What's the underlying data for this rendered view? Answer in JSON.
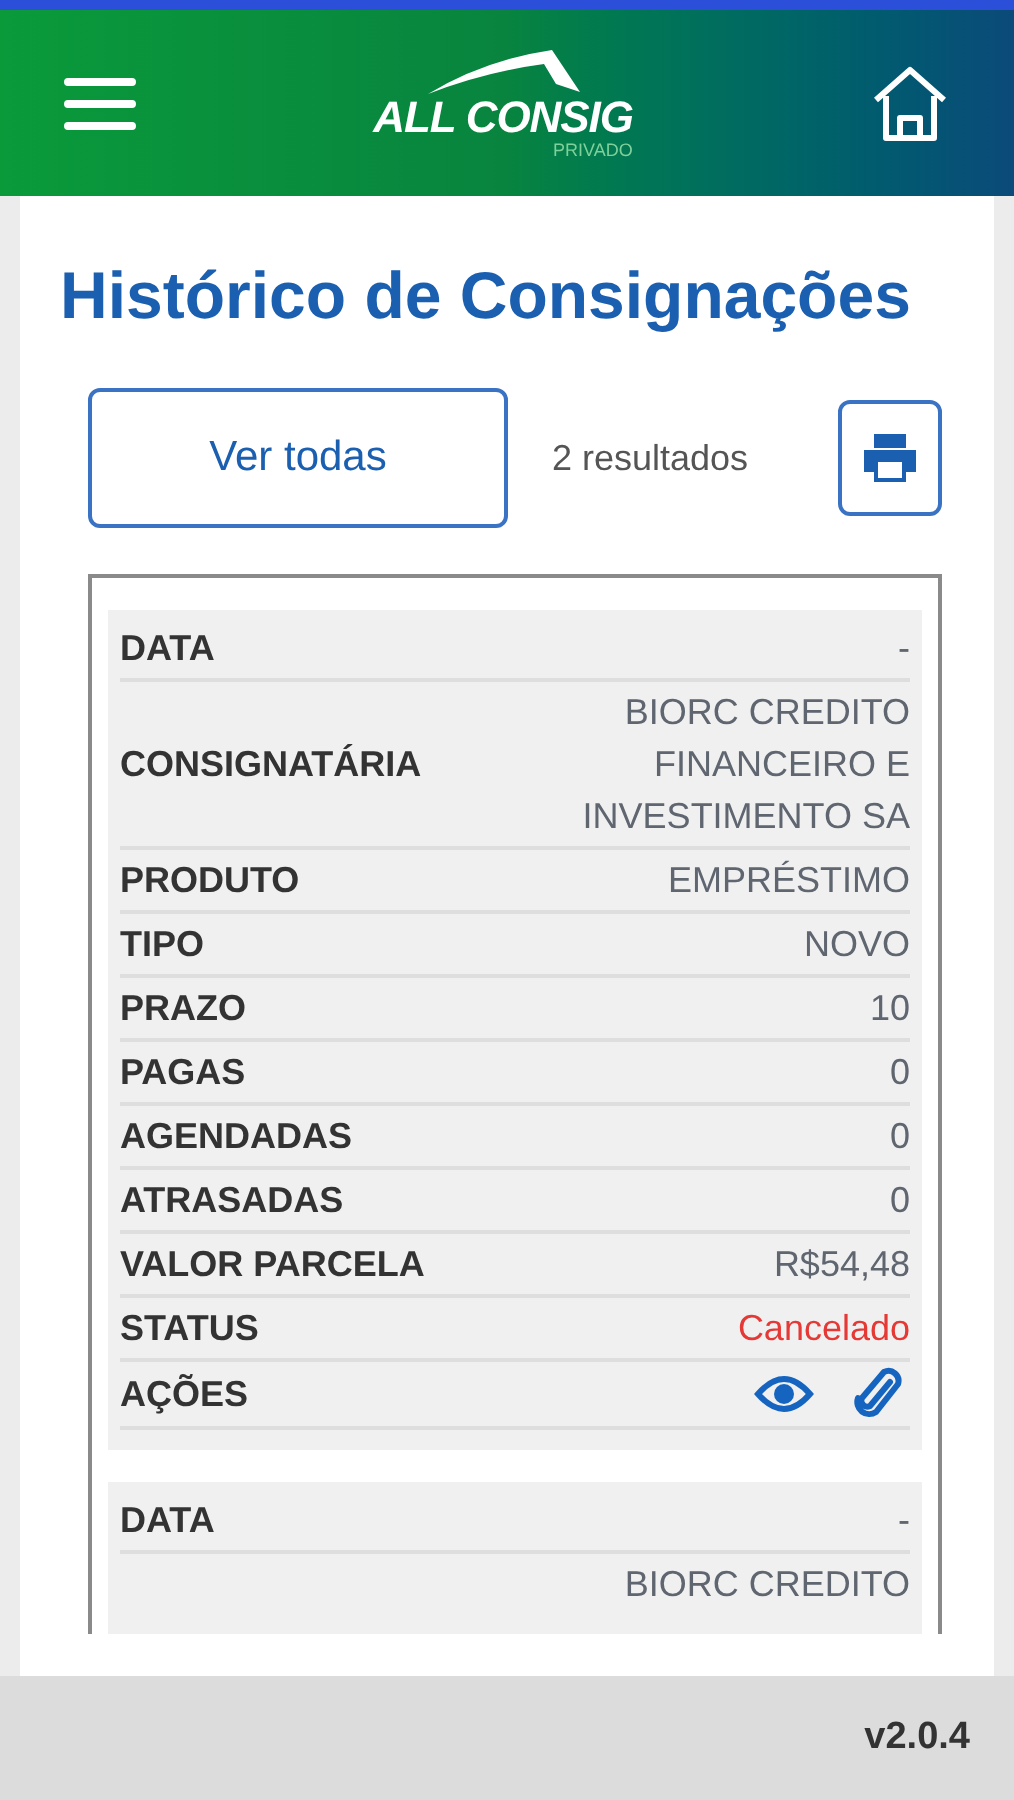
{
  "header": {
    "logo": "ALL CONSIG",
    "logo_sub": "PRIVADO"
  },
  "title": "Histórico de Consignações",
  "toolbar": {
    "button": "Ver todas",
    "results": "2 resultados"
  },
  "cards": [
    {
      "rows": [
        {
          "kind": "text",
          "label": "DATA",
          "value": "-"
        },
        {
          "kind": "text",
          "label": "CONSIGNATÁRIA",
          "value": "BIORC CREDITO FINANCEIRO E INVESTIMENTO SA"
        },
        {
          "kind": "text",
          "label": "PRODUTO",
          "value": "EMPRÉSTIMO"
        },
        {
          "kind": "text",
          "label": "TIPO",
          "value": "NOVO"
        },
        {
          "kind": "text",
          "label": "PRAZO",
          "value": "10"
        },
        {
          "kind": "text",
          "label": "PAGAS",
          "value": "0"
        },
        {
          "kind": "text",
          "label": "AGENDADAS",
          "value": "0"
        },
        {
          "kind": "text",
          "label": "ATRASADAS",
          "value": "0"
        },
        {
          "kind": "text",
          "label": "VALOR PARCELA",
          "value": "R$54,48"
        },
        {
          "kind": "status",
          "label": "STATUS",
          "value": "Cancelado",
          "color": "#e53935"
        },
        {
          "kind": "actions",
          "label": "AÇÕES"
        }
      ]
    },
    {
      "rows": [
        {
          "kind": "text",
          "label": "DATA",
          "value": "-"
        },
        {
          "kind": "text",
          "value": "BIORC CREDITO"
        }
      ]
    }
  ],
  "footer": {
    "version": "v2.0.4"
  }
}
